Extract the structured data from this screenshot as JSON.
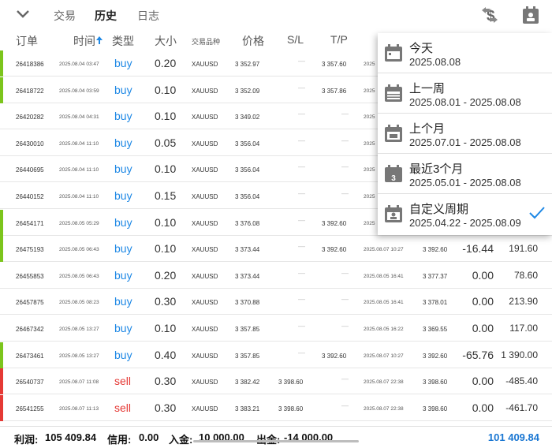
{
  "tabs": [
    {
      "label": "交易",
      "active": false
    },
    {
      "label": "历史",
      "active": true
    },
    {
      "label": "日志",
      "active": false
    }
  ],
  "columns": {
    "ticket": "订单",
    "time": "时间",
    "type": "类型",
    "size": "大小",
    "symbol": "交易品种",
    "price": "价格",
    "sl": "S/L",
    "tp": "T/P"
  },
  "rows": [
    {
      "ticket": "26418386",
      "time": "2025.08.04 03:47",
      "type": "buy",
      "size": "0.20",
      "symbol": "XAUUSD",
      "price": "3 352.97",
      "sl": "—",
      "tp": "3 357.60",
      "close_time": "2025",
      "close_price": "",
      "swap": "",
      "profit": "",
      "bar": "green"
    },
    {
      "ticket": "26418722",
      "time": "2025.08.04 03:59",
      "type": "buy",
      "size": "0.10",
      "symbol": "XAUUSD",
      "price": "3 352.09",
      "sl": "—",
      "tp": "3 357.86",
      "close_time": "2025",
      "close_price": "",
      "swap": "",
      "profit": "",
      "bar": "green"
    },
    {
      "ticket": "26420282",
      "time": "2025.08.04 04:31",
      "type": "buy",
      "size": "0.10",
      "symbol": "XAUUSD",
      "price": "3 349.02",
      "sl": "—",
      "tp": "—",
      "close_time": "2025",
      "close_price": "",
      "swap": "",
      "profit": "",
      "bar": "none"
    },
    {
      "ticket": "26430010",
      "time": "2025.08.04 11:10",
      "type": "buy",
      "size": "0.05",
      "symbol": "XAUUSD",
      "price": "3 356.04",
      "sl": "—",
      "tp": "—",
      "close_time": "2025",
      "close_price": "",
      "swap": "",
      "profit": "",
      "bar": "none"
    },
    {
      "ticket": "26440695",
      "time": "2025.08.04 11:10",
      "type": "buy",
      "size": "0.10",
      "symbol": "XAUUSD",
      "price": "3 356.04",
      "sl": "—",
      "tp": "—",
      "close_time": "2025",
      "close_price": "",
      "swap": "",
      "profit": "",
      "bar": "none"
    },
    {
      "ticket": "26440152",
      "time": "2025.08.04 11:10",
      "type": "buy",
      "size": "0.15",
      "symbol": "XAUUSD",
      "price": "3 356.04",
      "sl": "—",
      "tp": "—",
      "close_time": "2025",
      "close_price": "",
      "swap": "",
      "profit": "",
      "bar": "none"
    },
    {
      "ticket": "26454171",
      "time": "2025.08.05 05:29",
      "type": "buy",
      "size": "0.10",
      "symbol": "XAUUSD",
      "price": "3 376.08",
      "sl": "—",
      "tp": "3 392.60",
      "close_time": "2025",
      "close_price": "",
      "swap": "",
      "profit": "",
      "bar": "green"
    },
    {
      "ticket": "26475193",
      "time": "2025.08.05 06:43",
      "type": "buy",
      "size": "0.10",
      "symbol": "XAUUSD",
      "price": "3 373.44",
      "sl": "—",
      "tp": "3 392.60",
      "close_time": "2025.08.07 10:27",
      "close_price": "3 392.60",
      "swap": "-16.44",
      "profit": "191.60",
      "bar": "green"
    },
    {
      "ticket": "26455853",
      "time": "2025.08.05 06:43",
      "type": "buy",
      "size": "0.20",
      "symbol": "XAUUSD",
      "price": "3 373.44",
      "sl": "—",
      "tp": "—",
      "close_time": "2025.08.05 16:41",
      "close_price": "3 377.37",
      "swap": "0.00",
      "profit": "78.60",
      "bar": "none"
    },
    {
      "ticket": "26457875",
      "time": "2025.08.05 08:23",
      "type": "buy",
      "size": "0.30",
      "symbol": "XAUUSD",
      "price": "3 370.88",
      "sl": "—",
      "tp": "—",
      "close_time": "2025.08.05 16:41",
      "close_price": "3 378.01",
      "swap": "0.00",
      "profit": "213.90",
      "bar": "none"
    },
    {
      "ticket": "26467342",
      "time": "2025.08.05 13:27",
      "type": "buy",
      "size": "0.10",
      "symbol": "XAUUSD",
      "price": "3 357.85",
      "sl": "—",
      "tp": "—",
      "close_time": "2025.08.05 16:22",
      "close_price": "3 369.55",
      "swap": "0.00",
      "profit": "117.00",
      "bar": "none"
    },
    {
      "ticket": "26473461",
      "time": "2025.08.05 13:27",
      "type": "buy",
      "size": "0.40",
      "symbol": "XAUUSD",
      "price": "3 357.85",
      "sl": "—",
      "tp": "3 392.60",
      "close_time": "2025.08.07 10:27",
      "close_price": "3 392.60",
      "swap": "-65.76",
      "profit": "1 390.00",
      "bar": "green"
    },
    {
      "ticket": "26540737",
      "time": "2025.08.07 11:08",
      "type": "sell",
      "size": "0.30",
      "symbol": "XAUUSD",
      "price": "3 382.42",
      "sl": "3 398.60",
      "tp": "—",
      "close_time": "2025.08.07 22:38",
      "close_price": "3 398.60",
      "swap": "0.00",
      "profit": "-485.40",
      "bar": "red"
    },
    {
      "ticket": "26541255",
      "time": "2025.08.07 11:13",
      "type": "sell",
      "size": "0.30",
      "symbol": "XAUUSD",
      "price": "3 383.21",
      "sl": "3 398.60",
      "tp": "—",
      "close_time": "2025.08.07 22:38",
      "close_price": "3 398.60",
      "swap": "0.00",
      "profit": "-461.70",
      "bar": "red"
    }
  ],
  "dropdown": {
    "items": [
      {
        "title": "今天",
        "range": "2025.08.08",
        "icon": "calendar-day-icon",
        "selected": false
      },
      {
        "title": "上一周",
        "range": "2025.08.01 - 2025.08.08",
        "icon": "calendar-week-icon",
        "selected": false
      },
      {
        "title": "上个月",
        "range": "2025.07.01 - 2025.08.08",
        "icon": "calendar-month-icon",
        "selected": false
      },
      {
        "title": "最近3个月",
        "range": "2025.05.01 - 2025.08.08",
        "icon": "calendar-3-months-icon",
        "badge": "3",
        "selected": false
      },
      {
        "title": "自定义周期",
        "range": "2025.04.22 - 2025.08.09",
        "icon": "calendar-custom-icon",
        "selected": true
      }
    ]
  },
  "footer": {
    "profit_label": "利润:",
    "profit_value": "105 409.84",
    "credit_label": "信用:",
    "credit_value": "0.00",
    "deposit_label": "入金:",
    "deposit_value": "10 000.00",
    "withdrawal_label": "出金:",
    "withdrawal_value": "-14 000.00",
    "total": "101 409.84"
  },
  "colors": {
    "buy": "#1e88e5",
    "sell": "#e53935",
    "tp_bar": "#7cc51c",
    "sl_bar": "#e53935",
    "check": "#1e88e5",
    "total": "#1976d2"
  }
}
